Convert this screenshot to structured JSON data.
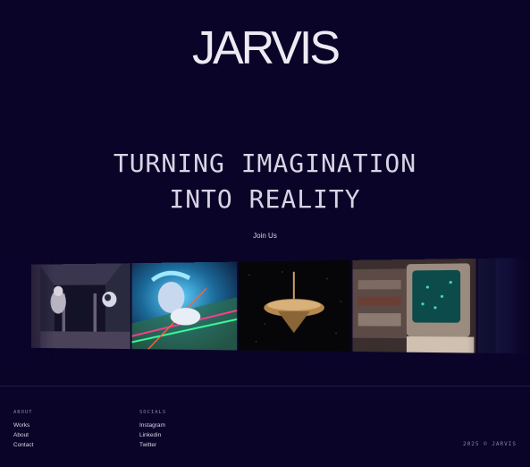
{
  "header": {
    "logo": "JARVIS"
  },
  "hero": {
    "line1": "TURNING IMAGINATION",
    "line2": "INTO REALITY"
  },
  "cta": {
    "label": "Join Us"
  },
  "gallery": {
    "images": [
      {
        "name": "astronaut-corridor-image"
      },
      {
        "name": "neon-dancer-image"
      },
      {
        "name": "spinning-top-image"
      },
      {
        "name": "retro-tv-image"
      }
    ]
  },
  "footer": {
    "about": {
      "title": "ABOUT",
      "links": [
        "Works",
        "About",
        "Contact"
      ]
    },
    "socials": {
      "title": "SOCIALS",
      "links": [
        "Instagram",
        "Linkedin",
        "Twitter"
      ]
    },
    "copyright": "2025 © JARVIS"
  },
  "colors": {
    "background": "#0b0429",
    "text": "#e6e3ee",
    "muted": "#8a84a3"
  }
}
